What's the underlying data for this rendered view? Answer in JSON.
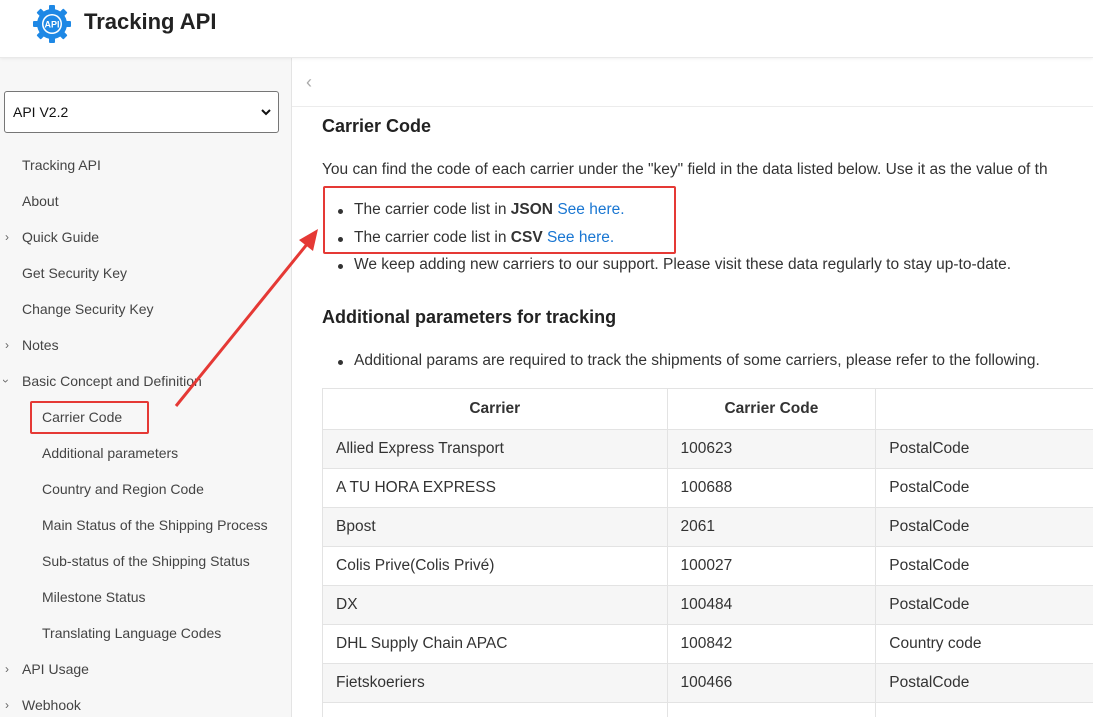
{
  "header": {
    "title": "Tracking API",
    "logo_text": "API"
  },
  "sidebar": {
    "version_select": {
      "value": "API V2.2"
    },
    "items": [
      {
        "label": "Tracking API",
        "expander": false,
        "level": 0
      },
      {
        "label": "About",
        "expander": false,
        "level": 0
      },
      {
        "label": "Quick Guide",
        "expander": true,
        "expanded": false,
        "level": 0
      },
      {
        "label": "Get Security Key",
        "expander": false,
        "level": 0
      },
      {
        "label": "Change Security Key",
        "expander": false,
        "level": 0
      },
      {
        "label": "Notes",
        "expander": true,
        "expanded": false,
        "level": 0
      },
      {
        "label": "Basic Concept and Definition",
        "expander": true,
        "expanded": true,
        "level": 0
      },
      {
        "label": "Carrier Code",
        "expander": false,
        "level": 1,
        "highlighted": true
      },
      {
        "label": "Additional parameters",
        "expander": false,
        "level": 1
      },
      {
        "label": "Country and Region Code",
        "expander": false,
        "level": 1
      },
      {
        "label": "Main Status of the Shipping Process",
        "expander": false,
        "level": 1
      },
      {
        "label": "Sub-status of the Shipping Status",
        "expander": false,
        "level": 1
      },
      {
        "label": "Milestone Status",
        "expander": false,
        "level": 1
      },
      {
        "label": "Translating Language Codes",
        "expander": false,
        "level": 1
      },
      {
        "label": "API Usage",
        "expander": true,
        "expanded": false,
        "level": 0
      },
      {
        "label": "Webhook",
        "expander": true,
        "expanded": false,
        "level": 0
      }
    ]
  },
  "main": {
    "section1_title": "Carrier Code",
    "intro": "You can find the code of each carrier under the \"key\" field in the data listed below. Use it as the value of th",
    "bullets": {
      "json_prefix": "The carrier code list in ",
      "json_bold": "JSON",
      "json_link": "See here.",
      "csv_prefix": "The carrier code list in ",
      "csv_bold": "CSV",
      "csv_link": "See here.",
      "keep_adding": "We keep adding new carriers to our support. Please visit these data regularly to stay up-to-date."
    },
    "section2_title": "Additional parameters for tracking",
    "section2_bullet": "Additional params are required to track the shipments of some carriers, please refer to the following.",
    "table": {
      "headers": [
        "Carrier",
        "Carrier Code",
        ""
      ],
      "rows": [
        [
          "Allied Express Transport",
          "100623",
          "PostalCode"
        ],
        [
          "A TU HORA EXPRESS",
          "100688",
          "PostalCode"
        ],
        [
          "Bpost",
          "2061",
          "PostalCode"
        ],
        [
          "Colis Prive(Colis Privé)",
          "100027",
          "PostalCode"
        ],
        [
          "DX",
          "100484",
          "PostalCode"
        ],
        [
          "DHL Supply Chain APAC",
          "100842",
          "Country code"
        ],
        [
          "Fietskoeriers",
          "100466",
          "PostalCode"
        ]
      ]
    }
  },
  "colors": {
    "annotation_red": "#e53935",
    "link_blue": "#1976d2",
    "logo_blue": "#1e88e5"
  },
  "icons": {
    "logo": "gear-api-icon",
    "select_chevron": "chevron-down-icon",
    "collapse": "chevron-left-icon",
    "expander": "chevron-right-icon"
  }
}
